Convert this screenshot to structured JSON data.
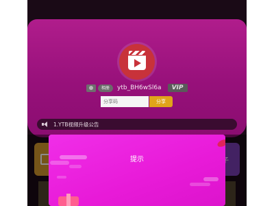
{
  "profile": {
    "camera_label": "相册",
    "user_id": "ytb_BH6wSl6a",
    "vip_badge": "VIP"
  },
  "share": {
    "placeholder": "分享码",
    "button_label": "分享"
  },
  "notice": {
    "text": "1.YTB视频升级公告"
  },
  "side_cards": {
    "right_label": "子"
  },
  "dialog": {
    "title": "提示"
  },
  "colors": {
    "header": "#a0147f",
    "share_button": "#e0a41a",
    "dialog": "#e81ad8",
    "vip_badge": "#5a5a5a"
  },
  "icons": [
    "film-logo-icon",
    "camera-icon",
    "speaker-icon",
    "document-icon",
    "gift-icon"
  ]
}
